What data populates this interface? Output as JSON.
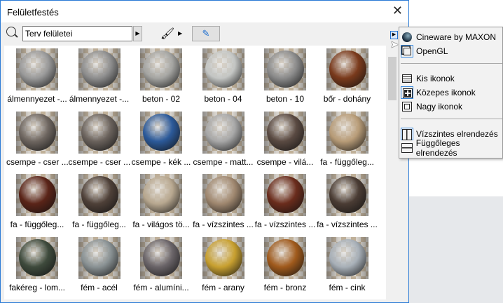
{
  "title": "Felületfestés",
  "search": {
    "value": "Terv felületei"
  },
  "materials": [
    {
      "label": "álmennyezet -...",
      "color": "#9a9a9a"
    },
    {
      "label": "álmennyezet -...",
      "color": "#8e8e8e"
    },
    {
      "label": "beton - 02",
      "color": "#a5a5a2"
    },
    {
      "label": "beton - 04",
      "color": "#c4c6c4"
    },
    {
      "label": "beton - 10",
      "color": "#8b8b8b"
    },
    {
      "label": "bőr - dohány",
      "color": "#7a3a1c"
    },
    {
      "label": "csempe - cser ...",
      "color": "#6e6660"
    },
    {
      "label": "csempe - cser ...",
      "color": "#6a625c"
    },
    {
      "label": "csempe - kék ...",
      "color": "#2c5a9a"
    },
    {
      "label": "csempe - matt...",
      "color": "#a8a8a8"
    },
    {
      "label": "csempe - vilá...",
      "color": "#5a4a42"
    },
    {
      "label": "fa - függőleg...",
      "color": "#b89c78"
    },
    {
      "label": "fa - függőleg...",
      "color": "#5a2418"
    },
    {
      "label": "fa - függőleg...",
      "color": "#4e4038"
    },
    {
      "label": "fa - világos tö...",
      "color": "#b8a890"
    },
    {
      "label": "fa - vízszintes ...",
      "color": "#a08870"
    },
    {
      "label": "fa - vízszintes ...",
      "color": "#6a2c1c"
    },
    {
      "label": "fa - vízszintes ...",
      "color": "#4a3c34"
    },
    {
      "label": "fakéreg - lom...",
      "color": "#3e4a3c"
    },
    {
      "label": "fém - acél",
      "color": "#8a9294"
    },
    {
      "label": "fém - alumíni...",
      "color": "#6a6468"
    },
    {
      "label": "fém - arany",
      "color": "#c8a030"
    },
    {
      "label": "fém - bronz",
      "color": "#a05a1c"
    },
    {
      "label": "fém - cink",
      "color": "#a8b0b8"
    }
  ],
  "menu": {
    "engines": [
      {
        "label": "Cineware by MAXON",
        "icon": "cineware-icon"
      },
      {
        "label": "OpenGL",
        "icon": "opengl-cube-icon",
        "selected": true
      }
    ],
    "sizes": [
      {
        "label": "Kis ikonok",
        "icon": "list-icon"
      },
      {
        "label": "Közepes ikonok",
        "icon": "medium-grid-icon",
        "selected": true
      },
      {
        "label": "Nagy ikonok",
        "icon": "large-icon"
      }
    ],
    "layouts": [
      {
        "label": "Vízszintes elrendezés",
        "icon": "horizontal-layout-icon",
        "selected": true
      },
      {
        "label": "Függőleges elrendezés",
        "icon": "vertical-layout-icon"
      }
    ]
  }
}
